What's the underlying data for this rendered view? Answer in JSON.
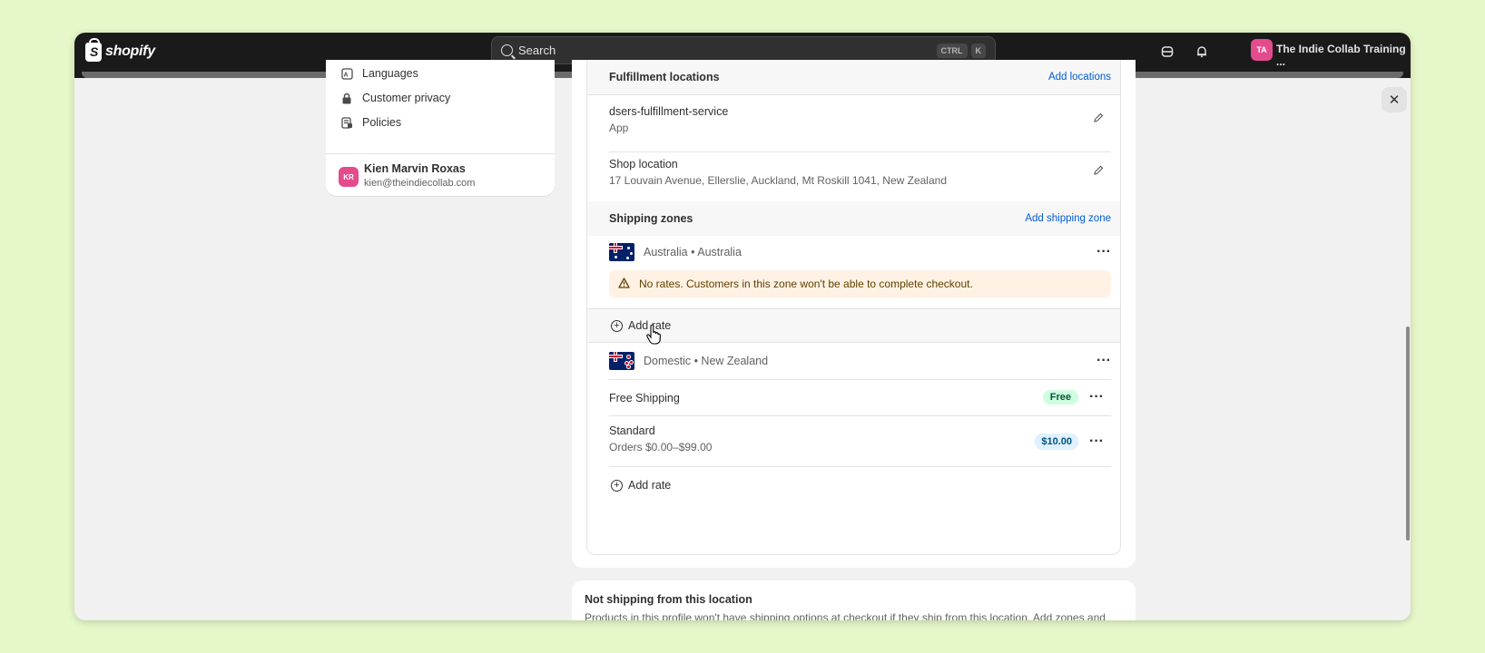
{
  "topbar": {
    "logo_text": "shopify",
    "search_placeholder": "Search",
    "kbd_ctrl": "CTRL",
    "kbd_k": "K",
    "avatar_initials": "TA",
    "store_name": "The Indie Collab Training ..."
  },
  "sidebar": {
    "items": [
      {
        "label": "Languages",
        "icon": "languages-icon"
      },
      {
        "label": "Customer privacy",
        "icon": "lock-icon"
      },
      {
        "label": "Policies",
        "icon": "policy-icon"
      }
    ],
    "user": {
      "initials": "KR",
      "name": "Kien Marvin Roxas",
      "email": "kien@theindiecollab.com"
    }
  },
  "fulfillment": {
    "title": "Fulfillment locations",
    "add_link": "Add locations",
    "locations": [
      {
        "name": "dsers-fulfillment-service",
        "detail": "App"
      },
      {
        "name": "Shop location",
        "detail": "17 Louvain Avenue, Ellerslie, Auckland, Mt Roskill 1041, New Zealand"
      }
    ]
  },
  "shipping_zones": {
    "title": "Shipping zones",
    "add_link": "Add shipping zone",
    "zones": [
      {
        "name": "Australia • Australia",
        "warning": "No rates. Customers in this zone won't be able to complete checkout.",
        "add_rate": "Add rate"
      },
      {
        "name": "Domestic • New Zealand",
        "rates": [
          {
            "name": "Free Shipping",
            "condition": "",
            "badge": "Free"
          },
          {
            "name": "Standard",
            "condition": "Orders $0.00–$99.00",
            "badge": "$10.00"
          }
        ],
        "add_rate": "Add rate"
      }
    ]
  },
  "not_shipping": {
    "title": "Not shipping from this location",
    "text": "Products in this profile won't have shipping options at checkout if they ship from this location. Add zones and rates to ship from this location."
  },
  "colors": {
    "topbar": "#1a1a1a",
    "link": "#005bd3",
    "warning_bg": "#fff1e3",
    "free_badge": "#cdfee1",
    "price_badge": "#e0f0ff",
    "avatar": "#e44b8d"
  }
}
